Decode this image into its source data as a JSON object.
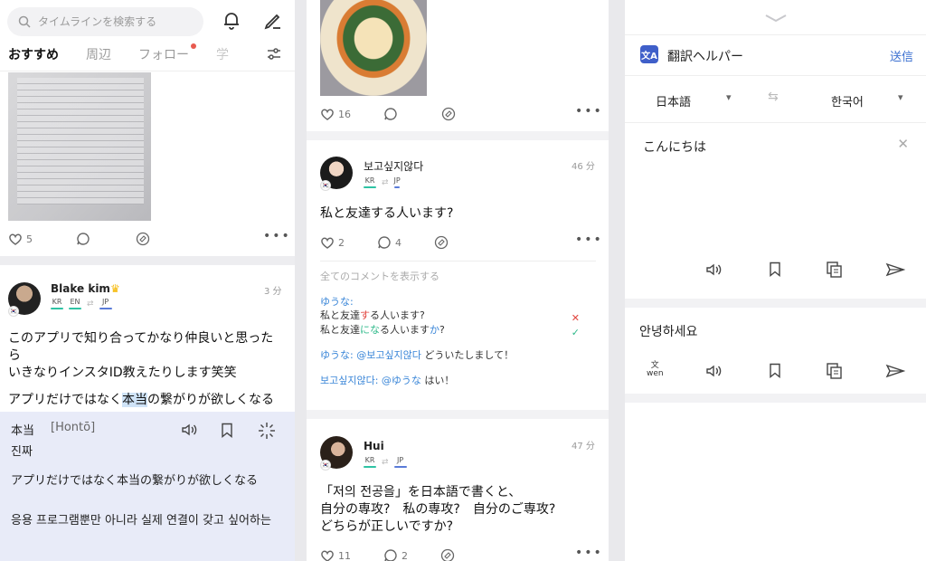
{
  "panel1": {
    "search_placeholder": "タイムラインを検索する",
    "tabs": [
      "おすすめ",
      "周辺",
      "フォロー",
      "学"
    ],
    "post1": {
      "likes": "5"
    },
    "post2": {
      "name": "Blake kim",
      "time": "3 分",
      "native": [
        "KR",
        "EN"
      ],
      "learning": [
        "JP"
      ],
      "text_l1": "このアプリで知り合ってかなり仲良いと思った",
      "text_l2": "ら",
      "text_l3": "いきなりインスタID教えたりします笑笑",
      "text_l4a": "アプリだけではなく",
      "text_l4b": "本当",
      "text_l4c": "の繋がりが欲しくなる"
    },
    "popup": {
      "word": "本当",
      "reading": "[Hontō]",
      "korean": "진짜",
      "sentence": "アプリだけではなく本当の繋がりが欲しくなる",
      "sentence_ko": "응용 프로그램뿐만 아니라 실제 연결이 갖고 싶어하는"
    }
  },
  "panel2": {
    "post_top": {
      "likes": "16"
    },
    "post_a": {
      "name": "보고싶지않다",
      "time": "46 分",
      "native": [
        "KR"
      ],
      "learning": [
        "JP"
      ],
      "text": "私と友達する人います?",
      "likes": "2",
      "comments": "4"
    },
    "comments": {
      "show_all": "全てのコメントを表示する",
      "c1_name": "ゆうな:",
      "c1_orig_a": "私と友達",
      "c1_orig_b": "す",
      "c1_orig_c": "る人います?",
      "c1_fix_a": "私と友達",
      "c1_fix_b": "にな",
      "c1_fix_c": "る人います",
      "c1_fix_d": "か",
      "c1_fix_e": "?",
      "c2_name": "ゆうな: @보고싶지않다",
      "c2_text": " どういたしまして！",
      "c3_name": "보고싶지않다: @ゆうな",
      "c3_text": " はい！"
    },
    "post_b": {
      "name": "Hui",
      "time": "47 分",
      "native": [
        "KR"
      ],
      "learning": [
        "JP"
      ],
      "line1": "「저의 전공을」を日本語で書くと、",
      "line2": "自分の専攻?　私の専攻?　自分のご専攻?",
      "line3": "どちらが正しいですか?",
      "likes": "11",
      "comments": "2"
    }
  },
  "panel3": {
    "title": "翻訳ヘルパー",
    "send": "送信",
    "source_lang": "日本語",
    "target_lang": "한국어",
    "source_text": "こんにちは",
    "output_text": "안녕하세요",
    "wen_top": "文",
    "wen_bottom": "wen"
  }
}
